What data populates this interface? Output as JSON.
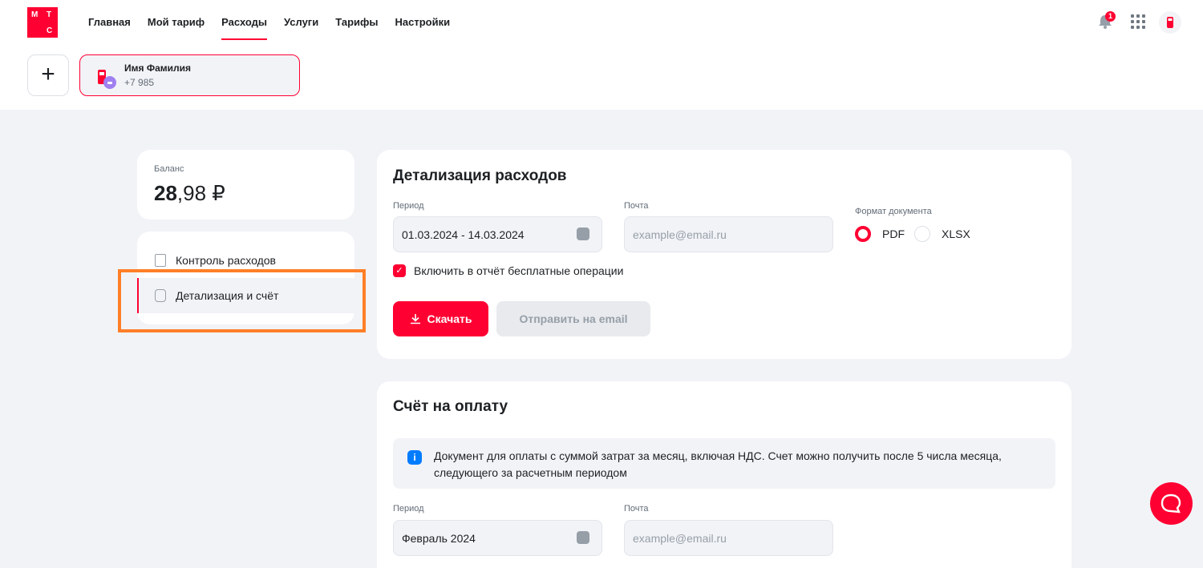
{
  "logo": {
    "letters": [
      "М",
      "Т",
      "С"
    ]
  },
  "nav": {
    "items": [
      {
        "label": "Главная"
      },
      {
        "label": "Мой тариф"
      },
      {
        "label": "Расходы"
      },
      {
        "label": "Услуги"
      },
      {
        "label": "Тарифы"
      },
      {
        "label": "Настройки"
      }
    ],
    "active": "Расходы"
  },
  "notifications": {
    "count": "1"
  },
  "profile": {
    "name": "Имя Фамилия",
    "phone": "+7 985"
  },
  "add_button": {
    "label": "+"
  },
  "balance": {
    "label": "Баланс",
    "integer": "28",
    "fraction": ",98 ₽"
  },
  "sidebar": {
    "items": [
      {
        "label": "Контроль расходов"
      },
      {
        "label": "Детализация и счёт"
      }
    ]
  },
  "detail": {
    "title": "Детализация расходов",
    "period_label": "Период",
    "period_value": "01.03.2024 - 14.03.2024",
    "email_label": "Почта",
    "email_placeholder": "example@email.ru",
    "format_label": "Формат документа",
    "formats": [
      {
        "label": "PDF",
        "selected": true
      },
      {
        "label": "XLSX",
        "selected": false
      }
    ],
    "include_free_label": "Включить в отчёт бесплатные операции",
    "download_label": "Скачать",
    "send_email_label": "Отправить на email"
  },
  "invoice": {
    "title": "Счёт на оплату",
    "info_text": "Документ для оплаты с суммой затрат за месяц, включая НДС. Счет можно получить после 5 числа месяца, следующего за расчетным периодом",
    "period_label": "Период",
    "period_value": "Февраль 2024",
    "email_label": "Почта",
    "email_placeholder": "example@email.ru"
  },
  "colors": {
    "accent": "#ff0032",
    "highlight": "#ff7f28",
    "info": "#007cff"
  }
}
